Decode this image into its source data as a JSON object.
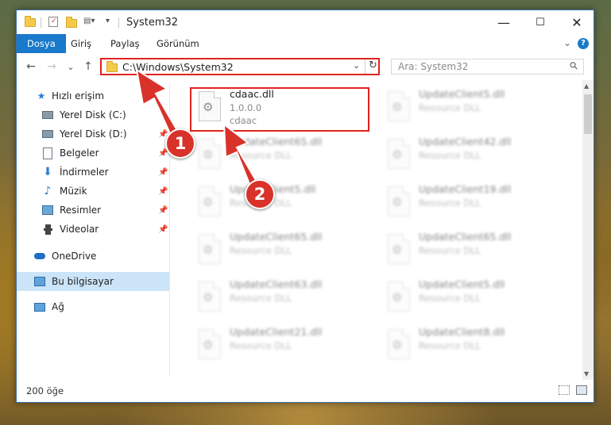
{
  "window": {
    "title": "System32",
    "controls": {
      "minimize": "—",
      "maximize": "☐",
      "close": "✕"
    }
  },
  "ribbon": {
    "tabs": [
      "Dosya",
      "Giriş",
      "Paylaş",
      "Görünüm"
    ],
    "help": "?"
  },
  "navigation": {
    "back": "←",
    "forward": "→",
    "recent": "⌄",
    "up": "↑"
  },
  "address_bar": {
    "path": "C:\\Windows\\System32",
    "dropdown": "⌄",
    "refresh": "↻"
  },
  "search": {
    "placeholder": "Ara: System32"
  },
  "sidebar": {
    "items": [
      {
        "label": "Hızlı erişim",
        "icon": "star-icon",
        "pinned": false
      },
      {
        "label": "Yerel Disk (C:)",
        "icon": "drive-icon",
        "pinned": true
      },
      {
        "label": "Yerel Disk (D:)",
        "icon": "drive-icon",
        "pinned": true
      },
      {
        "label": "Belgeler",
        "icon": "document-icon",
        "pinned": true
      },
      {
        "label": "İndirmeler",
        "icon": "download-icon",
        "pinned": true
      },
      {
        "label": "Müzik",
        "icon": "music-icon",
        "pinned": true
      },
      {
        "label": "Resimler",
        "icon": "pictures-icon",
        "pinned": true
      },
      {
        "label": "Videolar",
        "icon": "video-icon",
        "pinned": true
      },
      {
        "label": "OneDrive",
        "icon": "cloud-icon",
        "pinned": false
      },
      {
        "label": "Bu bilgisayar",
        "icon": "computer-icon",
        "pinned": false,
        "selected": true
      },
      {
        "label": "Ağ",
        "icon": "network-icon",
        "pinned": false
      }
    ]
  },
  "files": {
    "left": [
      {
        "name": "cdaac.dll",
        "version": "1.0.0.0",
        "description": "cdaac"
      },
      {
        "name": "UpdateClient65.dll",
        "description": "Resource DLL"
      },
      {
        "name": "UpdateClient5.dll",
        "description": "Resource DLL"
      },
      {
        "name": "UpdateClient65.dll",
        "description": "Resource DLL"
      },
      {
        "name": "UpdateClient63.dll",
        "description": "Resource DLL"
      },
      {
        "name": "UpdateClient21.dll",
        "description": "Resource DLL"
      }
    ],
    "right": [
      {
        "name": "UpdateClient5.dll",
        "description": "Resource DLL"
      },
      {
        "name": "UpdateClient42.dll",
        "description": "Resource DLL"
      },
      {
        "name": "UpdateClient19.dll",
        "description": "Resource DLL"
      },
      {
        "name": "UpdateClient65.dll",
        "description": "Resource DLL"
      },
      {
        "name": "UpdateClient5.dll",
        "description": "Resource DLL"
      },
      {
        "name": "UpdateClient8.dll",
        "description": "Resource DLL"
      }
    ]
  },
  "status_bar": {
    "item_count": "200 öğe"
  },
  "annotations": {
    "marker1": "1",
    "marker2": "2",
    "color": "#e0231d"
  }
}
